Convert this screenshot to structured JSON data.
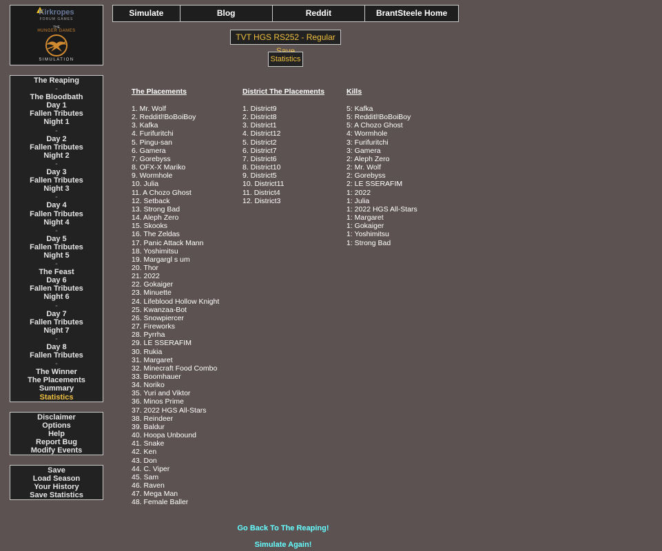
{
  "logo": {
    "brand": "Kirkropes",
    "brand_sub": "FORUM GAMES",
    "the": "THE",
    "title": "HUNGER GAMES",
    "bottom": "SIMULATION"
  },
  "topnav": [
    "Simulate",
    "Blog",
    "Reddit",
    "BrantSteele Home"
  ],
  "season_label": "TVT HGS RS252 - Regular Save",
  "page_label": "Statistics",
  "sidebar": {
    "nav": [
      {
        "label": "The Reaping",
        "sep": false
      },
      {
        "label": "-",
        "sep": true
      },
      {
        "label": "The Bloodbath",
        "sep": false
      },
      {
        "label": "Day 1",
        "sep": false
      },
      {
        "label": "Fallen Tributes",
        "sep": false
      },
      {
        "label": "Night 1",
        "sep": false
      },
      {
        "label": "-",
        "sep": true
      },
      {
        "label": "Day 2",
        "sep": false
      },
      {
        "label": "Fallen Tributes",
        "sep": false
      },
      {
        "label": "Night 2",
        "sep": false
      },
      {
        "label": "-",
        "sep": true
      },
      {
        "label": "Day 3",
        "sep": false
      },
      {
        "label": "Fallen Tributes",
        "sep": false
      },
      {
        "label": "Night 3",
        "sep": false
      },
      {
        "label": "-",
        "sep": true
      },
      {
        "label": "Day 4",
        "sep": false
      },
      {
        "label": "Fallen Tributes",
        "sep": false
      },
      {
        "label": "Night 4",
        "sep": false
      },
      {
        "label": "-",
        "sep": true
      },
      {
        "label": "Day 5",
        "sep": false
      },
      {
        "label": "Fallen Tributes",
        "sep": false
      },
      {
        "label": "Night 5",
        "sep": false
      },
      {
        "label": "-",
        "sep": true
      },
      {
        "label": "The Feast",
        "sep": false
      },
      {
        "label": "Day 6",
        "sep": false
      },
      {
        "label": "Fallen Tributes",
        "sep": false
      },
      {
        "label": "Night 6",
        "sep": false
      },
      {
        "label": "-",
        "sep": true
      },
      {
        "label": "Day 7",
        "sep": false
      },
      {
        "label": "Fallen Tributes",
        "sep": false
      },
      {
        "label": "Night 7",
        "sep": false
      },
      {
        "label": "-",
        "sep": true
      },
      {
        "label": "Day 8",
        "sep": false
      },
      {
        "label": "Fallen Tributes",
        "sep": false
      },
      {
        "label": "-",
        "sep": true
      },
      {
        "label": "The Winner",
        "sep": false
      },
      {
        "label": "The Placements",
        "sep": false
      },
      {
        "label": "Summary",
        "sep": false
      },
      {
        "label": "Statistics",
        "sep": false,
        "active": true
      }
    ],
    "options": [
      "Disclaimer",
      "Options",
      "Help",
      "Report Bug",
      "Modify Events"
    ],
    "save": [
      "Save",
      "Load Season",
      "Your History",
      "Save Statistics"
    ]
  },
  "placements": {
    "heading": "The Placements",
    "items": [
      "1. Mr. Wolf",
      "2. Redditl!BoBoiBoy",
      "3. Kafka",
      "4. Furifuritchi",
      "5. Pingu-san",
      "6. Gamera",
      "7. Gorebyss",
      "8. OFX-X Mariko",
      "9. Wormhole",
      "10. Julia",
      "11. A Chozo Ghost",
      "12. Setback",
      "13. Strong Bad",
      "14. Aleph Zero",
      "15. Skooks",
      "16. The Zeldas",
      "17. Panic Attack Mann",
      "18. Yoshimitsu",
      "19. Margargl s um",
      "20. Thor",
      "21. 2022",
      "22. Gokaiger",
      "23. Minuette",
      "24. Lifeblood Hollow Knight",
      "25. Kwanzaa-Bot",
      "26. Snowpiercer",
      "27. Fireworks",
      "28. Pyrrha",
      "29. LE SSERAFIM",
      "30. Rukia",
      "31. Margaret",
      "32. Minecraft Food Combo",
      "33. Boomhauer",
      "34. Noriko",
      "35. Yuri and Viktor",
      "36. Minos Prime",
      "37. 2022 HGS All-Stars",
      "38. Reindeer",
      "39. Baldur",
      "40. Hoopa Unbound",
      "41. Snake",
      "42. Ken",
      "43. Don",
      "44. C. Viper",
      "45. Sam",
      "46. Raven",
      "47. Mega Man",
      "48. Female Baller"
    ]
  },
  "district_placements": {
    "heading": "District The Placements",
    "items": [
      "1. District9",
      "2. District8",
      "3. District1",
      "4. District12",
      "5. District2",
      "6. District7",
      "7. District6",
      "8. District10",
      "9. District5",
      "10. District11",
      "11. District4",
      "12. District3"
    ]
  },
  "kills": {
    "heading": "Kills",
    "items": [
      "5: Kafka",
      "5: Redditl!BoBoiBoy",
      "5: A Chozo Ghost",
      "4: Wormhole",
      "3: Furifuritchi",
      "3: Gamera",
      "2: Aleph Zero",
      "2: Mr. Wolf",
      "2: Gorebyss",
      "2: LE SSERAFIM",
      "1: 2022",
      "1: Julia",
      "1: 2022 HGS All-Stars",
      "1: Margaret",
      "1: Gokaiger",
      "1: Yoshimitsu",
      "1: Strong Bad"
    ]
  },
  "footer": {
    "back": "Go Back To The Reaping!",
    "again": "Simulate Again!"
  }
}
